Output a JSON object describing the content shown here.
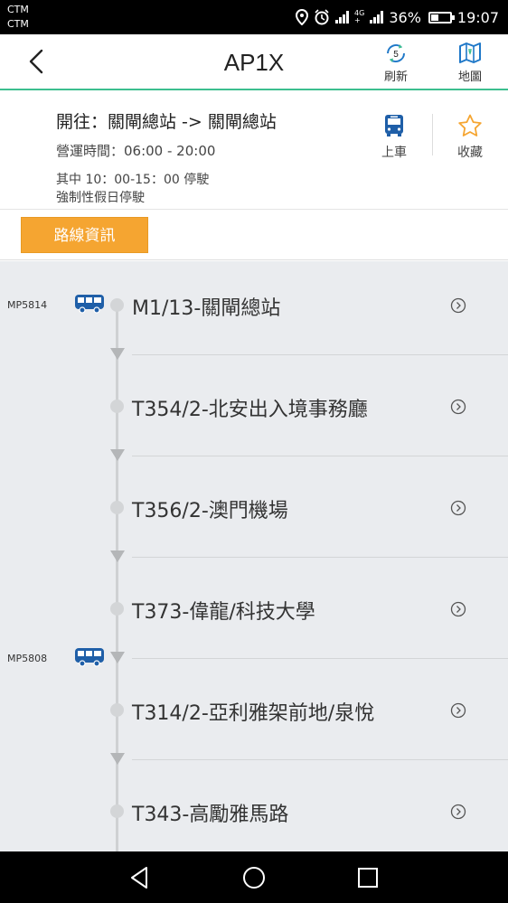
{
  "status_bar": {
    "carrier_1": "CTM",
    "carrier_2": "CTM",
    "network_tag_top": "4G",
    "network_tag_bottom": "+",
    "battery": "36%",
    "battery_level": 0.36,
    "time": "19:07",
    "icons": [
      "location-icon",
      "alarm-icon",
      "signal-icon",
      "battery-icon"
    ]
  },
  "header": {
    "title": "AP1X",
    "refresh_count": "5",
    "refresh_label": "刷新",
    "map_label": "地圖",
    "accent_color": "#3cbf8f"
  },
  "route": {
    "destination": "開往：關閘總站 -> 關閘總站",
    "hours": "營運時間：06:00 - 20:00",
    "note_1": "其中 10：00-15：00 停駛",
    "note_2": "強制性假日停駛",
    "board_label": "上車",
    "favorite_label": "收藏"
  },
  "tab": {
    "route_info_label": "路線資訊",
    "color": "#f5a531"
  },
  "stops": [
    {
      "name": "M1/13-關閘總站"
    },
    {
      "name": "T354/2-北安出入境事務廳"
    },
    {
      "name": "T356/2-澳門機場"
    },
    {
      "name": "T373-偉龍/科技大學"
    },
    {
      "name": "T314/2-亞利雅架前地/泉悅"
    },
    {
      "name": "T343-高勵雅馬路"
    }
  ],
  "buses": [
    {
      "id": "MP5814"
    },
    {
      "id": "MP5808"
    }
  ],
  "bus_color": "#1f5fa8"
}
